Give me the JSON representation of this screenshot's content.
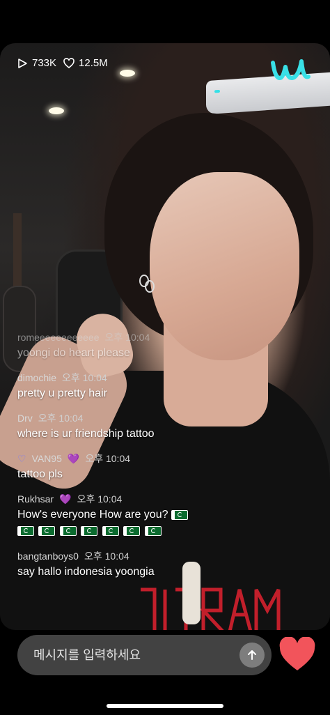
{
  "stats": {
    "views": "733K",
    "likes": "12.5M",
    "view_icon": "play-icon",
    "like_icon": "heart-outline-icon"
  },
  "brand": {
    "logo": "weverse-logo",
    "accent_color": "#39e0e6"
  },
  "chat": [
    {
      "user": "romeeeeeeeeeeee",
      "time": "오후 10:04",
      "text": "yoongi do heart please",
      "faded": true
    },
    {
      "user": "dimochie",
      "time": "오후 10:04",
      "text": "pretty u pretty hair"
    },
    {
      "user": "Drv",
      "time": "오후 10:04",
      "text": "where is ur friendship tattoo"
    },
    {
      "user": "VAN95",
      "time": "오후 10:04",
      "text": "tattoo pls",
      "badge": "💜"
    },
    {
      "user": "Rukhsar",
      "time": "오후 10:04",
      "text": "How's everyone How are you?",
      "badge": "💜"
    },
    {
      "user": "bangtanboys0",
      "time": "오후 10:04",
      "text": "say hallo indonesia yoongia"
    }
  ],
  "composer": {
    "placeholder": "메시지를 입력하세요",
    "send_icon": "arrow-up-icon",
    "like_icon": "heart-filled-icon",
    "heart_color": "#f2545b"
  }
}
